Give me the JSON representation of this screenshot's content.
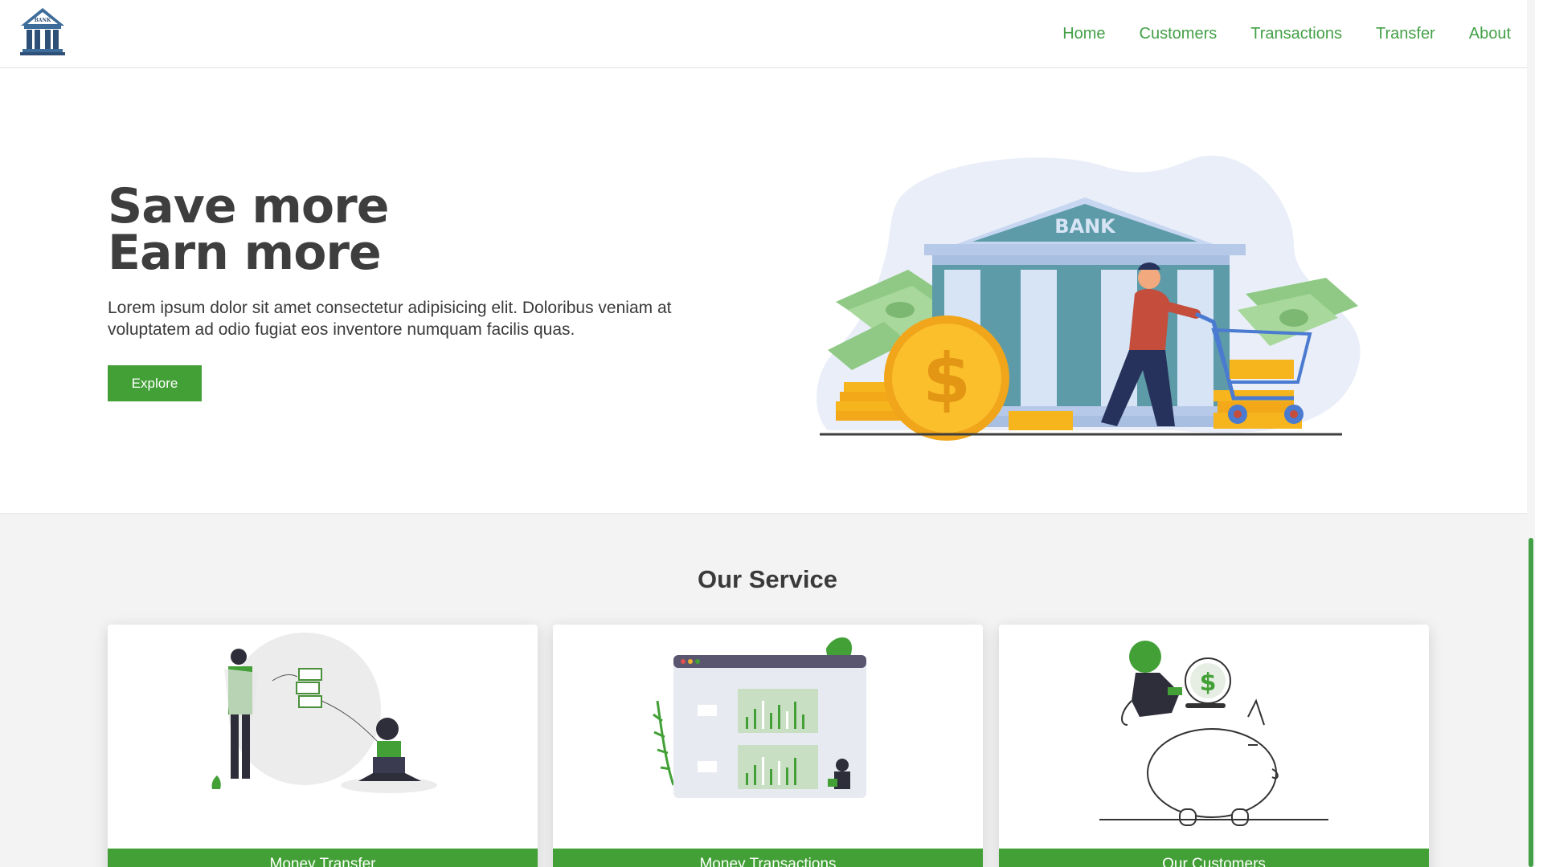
{
  "header": {
    "logo_text": "BANK",
    "nav": [
      "Home",
      "Customers",
      "Transactions",
      "Transfer",
      "About"
    ]
  },
  "hero": {
    "title_line1": "Save more",
    "title_line2": "Earn more",
    "text": "Lorem ipsum dolor sit amet consectetur adipisicing elit. Doloribus veniam at voluptatem ad odio fugiat eos inventore numquam facilis quas.",
    "button": "Explore",
    "illustration_label": "BANK"
  },
  "services": {
    "title": "Our Service",
    "cards": [
      "Money Transfer",
      "Money Transactions",
      "Our Customers"
    ]
  },
  "colors": {
    "accent": "#43a037",
    "nav": "#43a047",
    "services_bg": "#f3f3f3"
  }
}
